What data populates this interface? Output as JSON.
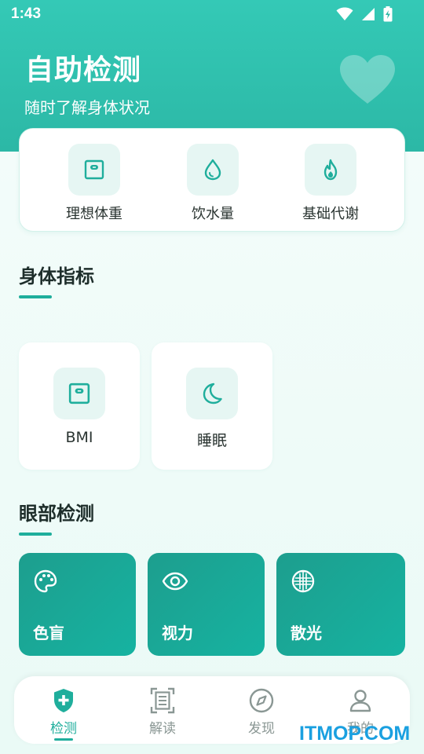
{
  "status_bar": {
    "time": "1:43"
  },
  "header": {
    "title": "自助检测",
    "subtitle": "随时了解身体状况"
  },
  "quick_actions": [
    {
      "label": "理想体重",
      "icon": "scale-icon"
    },
    {
      "label": "饮水量",
      "icon": "water-drop-icon"
    },
    {
      "label": "基础代谢",
      "icon": "flame-icon"
    }
  ],
  "body_section": {
    "title": "身体指标",
    "items": [
      {
        "label": "BMI",
        "icon": "scale-icon"
      },
      {
        "label": "睡眠",
        "icon": "moon-icon"
      }
    ]
  },
  "eye_section": {
    "title": "眼部检测",
    "items": [
      {
        "label": "色盲",
        "icon": "palette-icon"
      },
      {
        "label": "视力",
        "icon": "eye-icon"
      },
      {
        "label": "散光",
        "icon": "grid-circle-icon"
      }
    ]
  },
  "bottom_nav": [
    {
      "label": "检测",
      "icon": "shield-plus-icon",
      "active": true
    },
    {
      "label": "解读",
      "icon": "document-scan-icon",
      "active": false
    },
    {
      "label": "发现",
      "icon": "compass-icon",
      "active": false
    },
    {
      "label": "我的",
      "icon": "user-icon",
      "active": false
    }
  ],
  "watermark": "ITMOP.COM",
  "colors": {
    "primary": "#1fae9c",
    "header": "#34c9b6",
    "card_bg": "#ffffff",
    "icon_bg": "#e6f6f3"
  }
}
